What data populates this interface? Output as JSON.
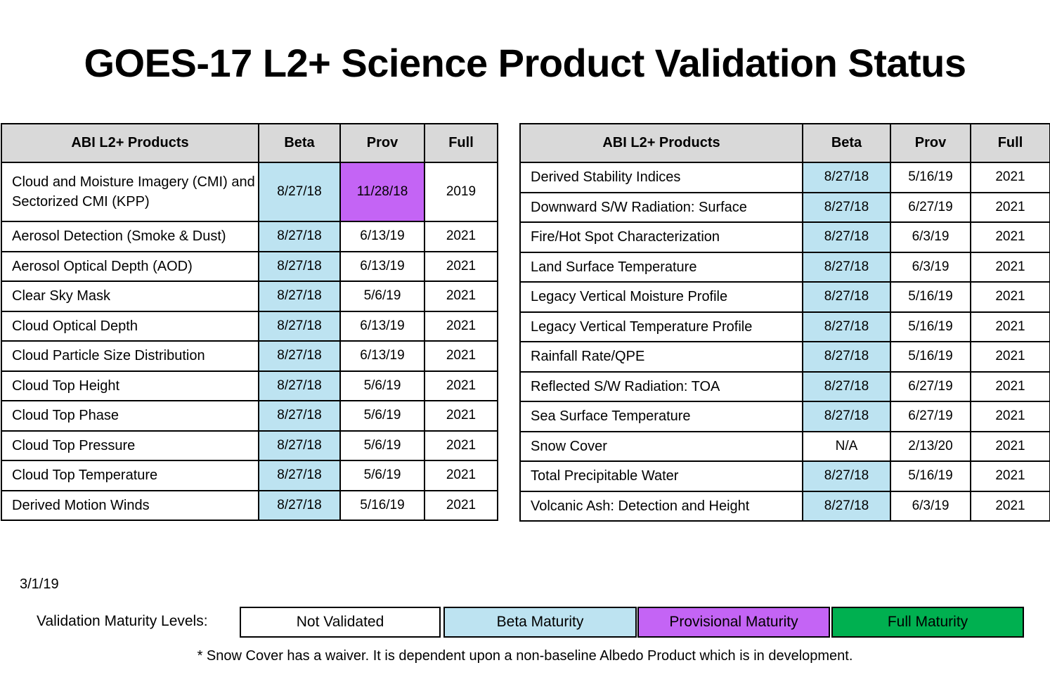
{
  "title": "GOES-17 L2+ Science Product Validation Status",
  "colors": {
    "header": "#d9d9d9",
    "beta": "#bde3f1",
    "provisional": "#c464f5",
    "full": "#00b050",
    "not_validated": "#ffffff"
  },
  "headers": [
    "ABI L2+ Products",
    "Beta",
    "Prov",
    "Full"
  ],
  "left_rows": [
    {
      "name": "Cloud and Moisture Imagery (CMI) and Sectorized CMI (KPP)",
      "beta": "8/27/18",
      "prov": "11/28/18",
      "full": "2019",
      "beta_status": "beta",
      "prov_status": "provisional"
    },
    {
      "name": "Aerosol Detection (Smoke & Dust)",
      "beta": "8/27/18",
      "prov": "6/13/19",
      "full": "2021",
      "beta_status": "beta",
      "prov_status": "none"
    },
    {
      "name": "Aerosol Optical Depth (AOD)",
      "beta": "8/27/18",
      "prov": "6/13/19",
      "full": "2021",
      "beta_status": "beta",
      "prov_status": "none"
    },
    {
      "name": "Clear Sky Mask",
      "beta": "8/27/18",
      "prov": "5/6/19",
      "full": "2021",
      "beta_status": "beta",
      "prov_status": "none"
    },
    {
      "name": "Cloud Optical Depth",
      "beta": "8/27/18",
      "prov": "6/13/19",
      "full": "2021",
      "beta_status": "beta",
      "prov_status": "none"
    },
    {
      "name": "Cloud Particle Size Distribution",
      "beta": "8/27/18",
      "prov": "6/13/19",
      "full": "2021",
      "beta_status": "beta",
      "prov_status": "none"
    },
    {
      "name": "Cloud Top Height",
      "beta": "8/27/18",
      "prov": "5/6/19",
      "full": "2021",
      "beta_status": "beta",
      "prov_status": "none"
    },
    {
      "name": "Cloud Top Phase",
      "beta": "8/27/18",
      "prov": "5/6/19",
      "full": "2021",
      "beta_status": "beta",
      "prov_status": "none"
    },
    {
      "name": "Cloud Top Pressure",
      "beta": "8/27/18",
      "prov": "5/6/19",
      "full": "2021",
      "beta_status": "beta",
      "prov_status": "none"
    },
    {
      "name": "Cloud Top Temperature",
      "beta": "8/27/18",
      "prov": "5/6/19",
      "full": "2021",
      "beta_status": "beta",
      "prov_status": "none"
    },
    {
      "name": "Derived Motion Winds",
      "beta": "8/27/18",
      "prov": "5/16/19",
      "full": "2021",
      "beta_status": "beta",
      "prov_status": "none"
    }
  ],
  "right_rows": [
    {
      "name": "Derived Stability Indices",
      "beta": "8/27/18",
      "prov": "5/16/19",
      "full": "2021",
      "beta_status": "beta",
      "prov_status": "none"
    },
    {
      "name": "Downward S/W Radiation: Surface",
      "beta": "8/27/18",
      "prov": "6/27/19",
      "full": "2021",
      "beta_status": "beta",
      "prov_status": "none"
    },
    {
      "name": "Fire/Hot Spot Characterization",
      "beta": "8/27/18",
      "prov": "6/3/19",
      "full": "2021",
      "beta_status": "beta",
      "prov_status": "none"
    },
    {
      "name": "Land Surface Temperature",
      "beta": "8/27/18",
      "prov": "6/3/19",
      "full": "2021",
      "beta_status": "beta",
      "prov_status": "none"
    },
    {
      "name": "Legacy Vertical Moisture Profile",
      "beta": "8/27/18",
      "prov": "5/16/19",
      "full": "2021",
      "beta_status": "beta",
      "prov_status": "none"
    },
    {
      "name": "Legacy Vertical Temperature Profile",
      "beta": "8/27/18",
      "prov": "5/16/19",
      "full": "2021",
      "beta_status": "beta",
      "prov_status": "none"
    },
    {
      "name": "Rainfall Rate/QPE",
      "beta": "8/27/18",
      "prov": "5/16/19",
      "full": "2021",
      "beta_status": "beta",
      "prov_status": "none"
    },
    {
      "name": "Reflected S/W Radiation: TOA",
      "beta": "8/27/18",
      "prov": "6/27/19",
      "full": "2021",
      "beta_status": "beta",
      "prov_status": "none"
    },
    {
      "name": "Sea Surface Temperature",
      "beta": "8/27/18",
      "prov": "6/27/19",
      "full": "2021",
      "beta_status": "beta",
      "prov_status": "none"
    },
    {
      "name": "Snow Cover",
      "beta": "N/A",
      "prov": "2/13/20",
      "full": "2021",
      "beta_status": "none",
      "prov_status": "none"
    },
    {
      "name": "Total Precipitable Water",
      "beta": "8/27/18",
      "prov": "5/16/19",
      "full": "2021",
      "beta_status": "beta",
      "prov_status": "none"
    },
    {
      "name": "Volcanic Ash: Detection and Height",
      "beta": "8/27/18",
      "prov": "6/3/19",
      "full": "2021",
      "beta_status": "beta",
      "prov_status": "none"
    }
  ],
  "date": "3/1/19",
  "legend": {
    "label": "Validation Maturity Levels:",
    "items": [
      {
        "label": "Not Validated",
        "color": "#ffffff"
      },
      {
        "label": "Beta Maturity",
        "color": "#bde3f1"
      },
      {
        "label": "Provisional Maturity",
        "color": "#c464f5"
      },
      {
        "label": "Full Maturity",
        "color": "#00b050"
      }
    ]
  },
  "footnote": "* Snow Cover has a waiver. It is dependent upon a non-baseline Albedo Product which is in development."
}
